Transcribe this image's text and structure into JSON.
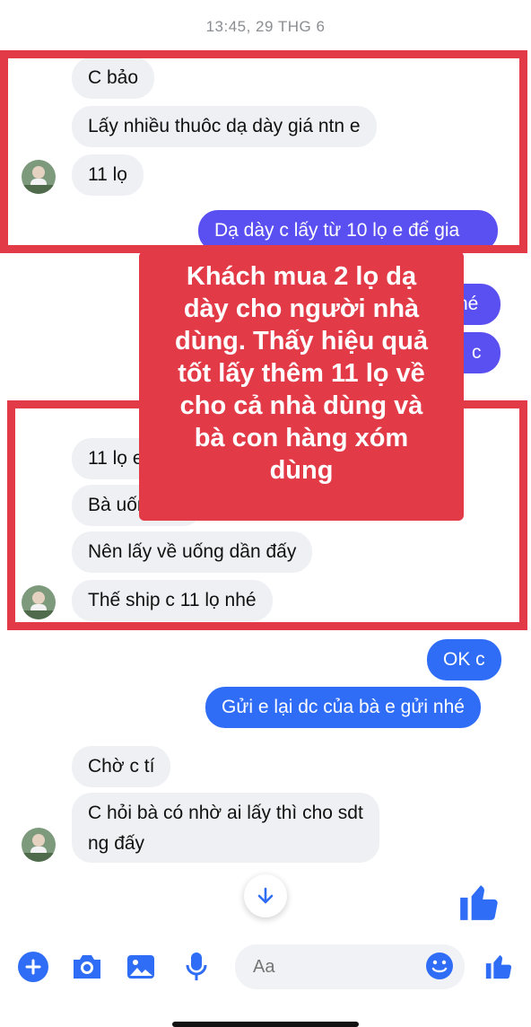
{
  "timestamp": "13:45, 29 THG 6",
  "messages_top": [
    {
      "text": "C bảo"
    },
    {
      "text": "Lấy nhiều thuôc dạ dày giá ntn e"
    },
    {
      "text": "11 lọ"
    }
  ],
  "outgoing_top": {
    "text": "Dạ dày c lấy từ 10 lọ e để gia"
  },
  "hidden_outgoing": [
    {
      "text": "hé"
    },
    {
      "text": "c"
    }
  ],
  "callout": {
    "lines": [
      "Khách mua 2 lọ dạ",
      "dày cho người nhà",
      "dùng. Thấy hiệu quả",
      "tốt lấy thêm 11 lọ về",
      "cho cả nhà dùng và",
      "bà con hàng xóm",
      "dùng"
    ]
  },
  "messages_mid": [
    {
      "text": "11 lọ e ạ"
    },
    {
      "text": "Bà uống đỡ"
    },
    {
      "text": "Nên lấy về uống dần đấy"
    },
    {
      "text": "Thế ship c 11 lọ nhé"
    }
  ],
  "outgoing_mid": [
    {
      "text": "OK c"
    },
    {
      "text": "Gửi e lại dc của bà e gửi nhé"
    }
  ],
  "messages_bottom": [
    {
      "text": "Chờ c tí"
    },
    {
      "line1": "C hỏi bà có nhờ ai lấy thì cho sdt",
      "line2": "ng đấy"
    }
  ],
  "composer": {
    "placeholder": "Aa"
  },
  "icons": {
    "plus": "plus-icon",
    "camera": "camera-icon",
    "image": "image-icon",
    "mic": "microphone-icon",
    "emoji": "emoji-icon",
    "like": "thumbs-up-icon",
    "scroll": "arrow-down-icon"
  },
  "colors": {
    "accent_red": "#e33a47",
    "messenger_blue": "#2f6df6",
    "messenger_purple": "#5a4ff0",
    "incoming_bg": "#eef0f3"
  }
}
